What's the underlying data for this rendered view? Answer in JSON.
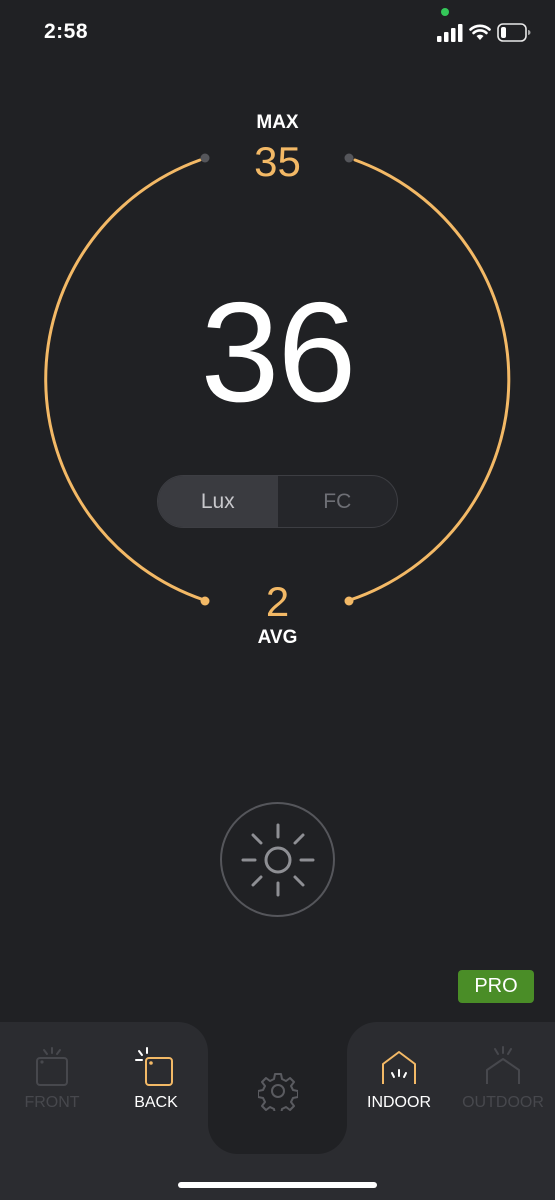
{
  "status_bar": {
    "time": "2:58",
    "signal_icon": "cellular-signal-icon",
    "wifi_icon": "wifi-icon",
    "battery_icon": "battery-low-icon",
    "battery_level": 0.2
  },
  "meter": {
    "max_label": "MAX",
    "max_value": "35",
    "current_value": "36",
    "avg_value": "2",
    "avg_label": "AVG"
  },
  "units": {
    "options": [
      "Lux",
      "FC"
    ],
    "selected": "Lux"
  },
  "light_button": {
    "icon": "sun-icon"
  },
  "pro_badge": "PRO",
  "tabs": {
    "front": "FRONT",
    "back": "BACK",
    "indoor": "INDOOR",
    "outdoor": "OUTDOOR"
  },
  "settings": {
    "icon": "gear-icon"
  },
  "colors": {
    "background": "#202124",
    "accent": "#f3b966",
    "pro_green": "#4a8d27",
    "panel": "#2b2c30"
  }
}
